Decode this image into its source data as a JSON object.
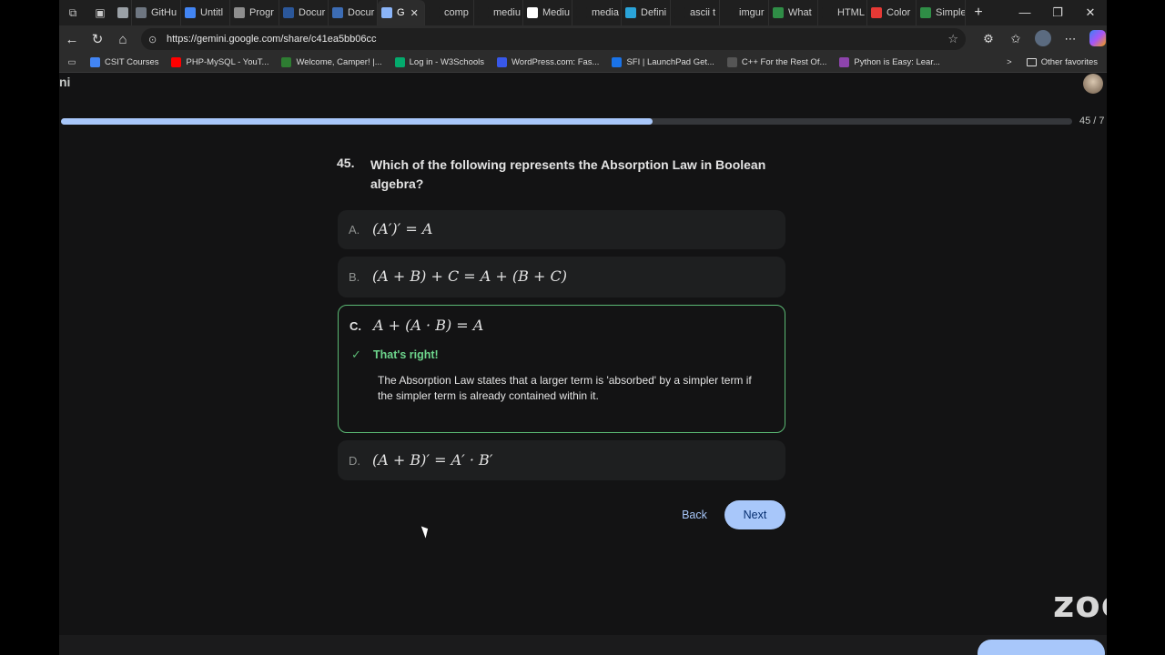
{
  "browser": {
    "tabs": [
      {
        "label": "",
        "color": "#9aa0a6"
      },
      {
        "label": "GitHu",
        "color": "#6e7681"
      },
      {
        "label": "Untitl",
        "color": "#4285f4"
      },
      {
        "label": "Progr",
        "color": "#8e8e8e"
      },
      {
        "label": "Docur",
        "color": "#2b579a"
      },
      {
        "label": "Docur",
        "color": "#3c6cb4"
      },
      {
        "label": "G",
        "color": "#8ab4f8",
        "active": true
      },
      {
        "label": "comp",
        "color": "#1f1f1f"
      },
      {
        "label": "mediu",
        "color": "#1f1f1f"
      },
      {
        "label": "Mediu",
        "color": "#ffffff"
      },
      {
        "label": "media",
        "color": "#1f1f1f"
      },
      {
        "label": "Defini",
        "color": "#2aa3d8"
      },
      {
        "label": "ascii t",
        "color": "#1f1f1f"
      },
      {
        "label": "imgur",
        "color": "#1f1f1f"
      },
      {
        "label": "What",
        "color": "#2f8d46"
      },
      {
        "label": "HTML",
        "color": "#1f1f1f"
      },
      {
        "label": "Color",
        "color": "#e53935"
      },
      {
        "label": "Simple",
        "color": "#2f8d46"
      }
    ],
    "active_tab_close": "✕",
    "new_tab": "+",
    "url": "https://gemini.google.com/share/c41ea5bb06cc",
    "bookmarks": [
      {
        "label": "CSIT Courses",
        "color": "#4285f4"
      },
      {
        "label": "PHP-MySQL - YouT...",
        "color": "#ff0000"
      },
      {
        "label": "Welcome, Camper! |...",
        "color": "#2e7d32"
      },
      {
        "label": "Log in - W3Schools",
        "color": "#04aa6d"
      },
      {
        "label": "WordPress.com: Fas...",
        "color": "#3858e9"
      },
      {
        "label": "SFI | LaunchPad Get...",
        "color": "#1a73e8"
      },
      {
        "label": "C++ For the Rest Of...",
        "color": "#555555"
      },
      {
        "label": "Python is Easy: Lear...",
        "color": "#8e44ad"
      }
    ],
    "bookmarks_more": ">",
    "other_favorites": "Other favorites"
  },
  "app": {
    "brand": "ni"
  },
  "quiz": {
    "progress_label": "45 / 7",
    "progress_fraction": 0.585,
    "question_number": "45.",
    "question_text": "Which of the following represents the Absorption Law in Boolean algebra?",
    "options": [
      {
        "letter": "A.",
        "formula": "(A′)′ = A"
      },
      {
        "letter": "B.",
        "formula": "(A + B) + C = A + (B + C)"
      },
      {
        "letter": "C.",
        "formula": "A + (A · B) = A",
        "correct": true
      },
      {
        "letter": "D.",
        "formula": "(A + B)′ = A′ · B′"
      }
    ],
    "feedback_title": "That's right!",
    "explanation": "The Absorption Law states that a larger term is 'absorbed' by a simpler term if the simpler term is already contained within it.",
    "back_label": "Back",
    "next_label": "Next"
  },
  "overlay": {
    "zoom_logo": "zoom"
  },
  "colors": {
    "accent": "#a8c7fa",
    "correct_border": "#5bb974",
    "correct_text": "#6dd58c",
    "page_bg": "#131314",
    "option_bg": "#1e1f20"
  }
}
